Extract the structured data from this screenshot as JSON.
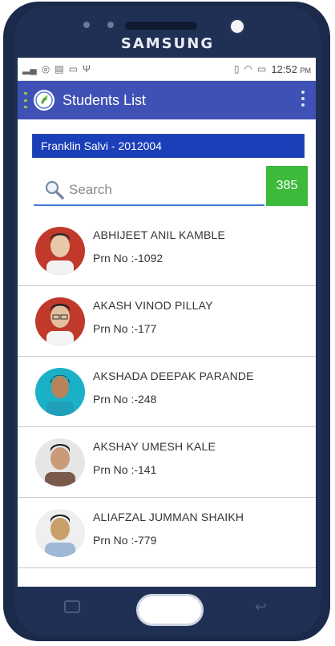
{
  "device": {
    "brand": "SAMSUNG"
  },
  "status_bar": {
    "time": "12:52",
    "period": "PM"
  },
  "app_bar": {
    "title": "Students List"
  },
  "teacher_label": "Franklin Salvi - 2012004",
  "search": {
    "placeholder": "Search",
    "value": ""
  },
  "student_count": "385",
  "students": [
    {
      "name": "ABHIJEET ANIL KAMBLE",
      "prn": "Prn No :-1092",
      "photo_bg": "#c0392b"
    },
    {
      "name": "AKASH VINOD PILLAY",
      "prn": "Prn No :-177",
      "photo_bg": "#c0392b"
    },
    {
      "name": "AKSHADA DEEPAK PARANDE",
      "prn": "Prn No :-248",
      "photo_bg": "#1ab0c8"
    },
    {
      "name": "AKSHAY UMESH KALE",
      "prn": "Prn No :-141",
      "photo_bg": "#e6e6e6"
    },
    {
      "name": "ALIAFZAL JUMMAN SHAIKH",
      "prn": "Prn No :-779",
      "photo_bg": "#efefef"
    }
  ],
  "colors": {
    "app_bar": "#3f51b5",
    "teacher_bar": "#1a3fb8",
    "count_badge": "#3cba3a"
  }
}
